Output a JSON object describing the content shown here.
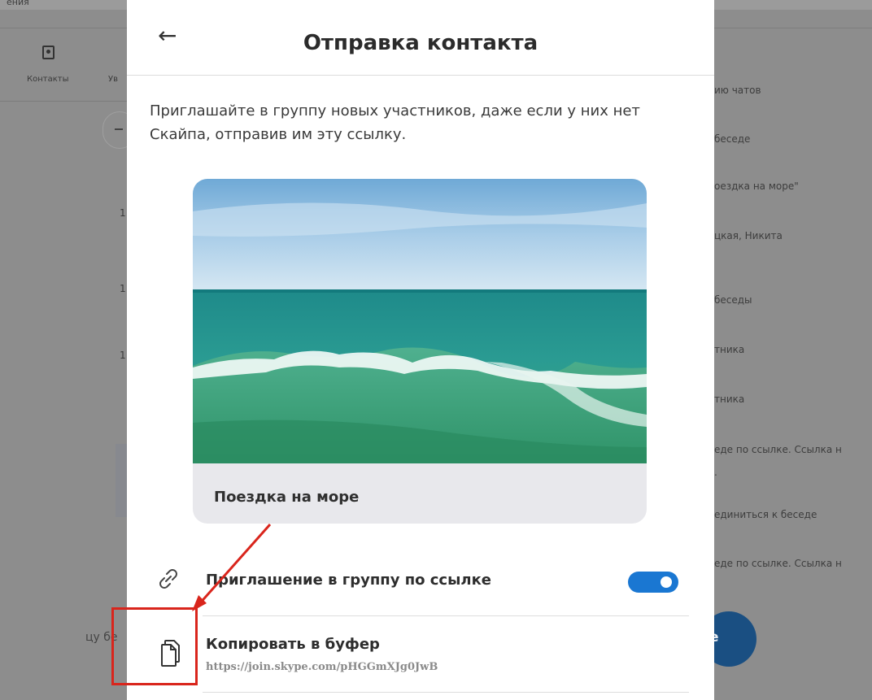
{
  "background": {
    "top_partial": "ения",
    "contacts_label": "Контакты",
    "tab_partial": "Ув",
    "left_numbers": [
      "1",
      "1",
      "1"
    ],
    "right_items": [
      "ию чатов",
      "беседе",
      "оездка на море\"",
      "цкая, Никита",
      "беседы",
      "тника",
      "тника",
      "еде по ссылке. Ссылка н",
      ".",
      "единиться к беседе",
      "еде по ссылке. Ссылка н"
    ],
    "left_partial_text": "цу бе",
    "blue_button_partial": "е"
  },
  "modal": {
    "back_icon": "arrow-left-icon",
    "title": "Отправка контакта",
    "description": "Приглашайте в группу новых участников, даже если у них нет Скайпа, отправив им эту ссылку.",
    "group_card": {
      "image": "sea-wave-photo",
      "title": "Поездка на море"
    },
    "invite_link": {
      "icon": "link-icon",
      "label": "Приглашение в группу по ссылке",
      "enabled": true
    },
    "copy": {
      "icon": "copy-icon",
      "label": "Копировать в буфер",
      "url": "https://join.skype.com/pHGGmXJg0JwB"
    }
  },
  "annotation": {
    "highlight_color": "#d9251c"
  },
  "colors": {
    "accent": "#1a77d2",
    "overlay": "#8d8d8d"
  }
}
